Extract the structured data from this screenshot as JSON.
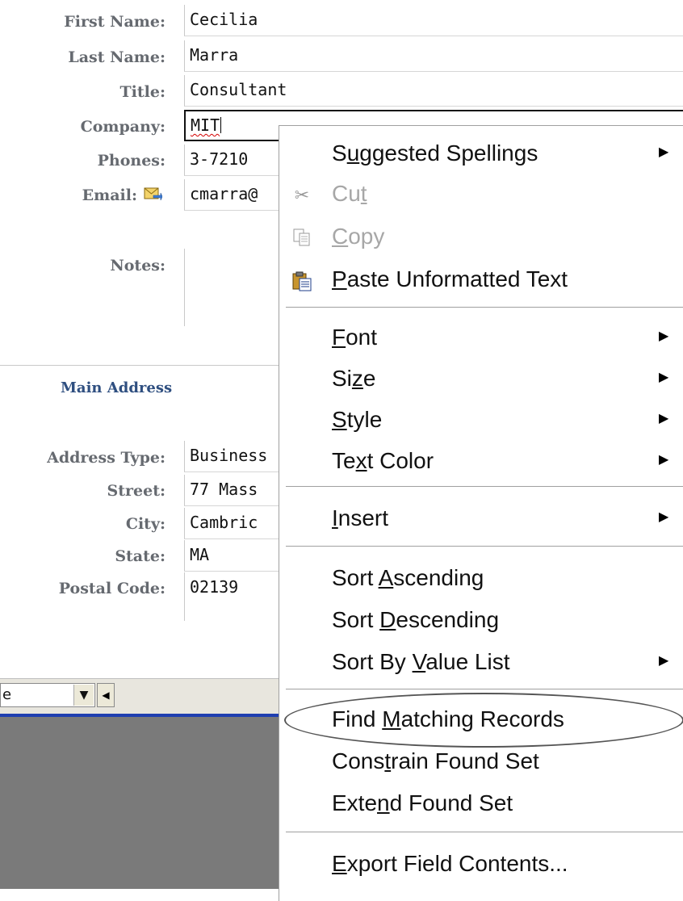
{
  "form": {
    "first_name": {
      "label": "First Name:",
      "value": "Cecilia"
    },
    "last_name": {
      "label": "Last Name:",
      "value": "Marra"
    },
    "title": {
      "label": "Title:",
      "value": "Consultant"
    },
    "company": {
      "label": "Company:",
      "value": "MIT"
    },
    "phones": {
      "label": "Phones:",
      "value": "3-7210"
    },
    "email": {
      "label": "Email:",
      "value": "cmarra@"
    },
    "notes": {
      "label": "Notes:",
      "value": ""
    }
  },
  "address": {
    "section_title": "Main Address",
    "type": {
      "label": "Address Type:",
      "value": "Business"
    },
    "street": {
      "label": "Street:",
      "value": "77 Mass"
    },
    "city": {
      "label": "City:",
      "value": "Cambric"
    },
    "state": {
      "label": "State:",
      "value": "MA"
    },
    "postal": {
      "label": "Postal Code:",
      "value": "02139"
    }
  },
  "statusbar": {
    "combo_value": "e"
  },
  "context_menu": {
    "items": [
      {
        "pre": "S",
        "key": "u",
        "post": "ggested Spellings",
        "submenu": true
      },
      {
        "pre": "Cu",
        "key": "t",
        "post": "",
        "disabled": true,
        "icon": "cut-icon"
      },
      {
        "pre": "",
        "key": "C",
        "post": "opy",
        "disabled": true,
        "icon": "copy-icon"
      },
      {
        "pre": "",
        "key": "P",
        "post": "aste Unformatted Text",
        "icon": "paste-icon"
      },
      {
        "pre": "",
        "key": "F",
        "post": "ont",
        "submenu": true
      },
      {
        "pre": "Si",
        "key": "z",
        "post": "e",
        "submenu": true
      },
      {
        "pre": "",
        "key": "S",
        "post": "tyle",
        "submenu": true
      },
      {
        "pre": "Te",
        "key": "x",
        "post": "t Color",
        "submenu": true
      },
      {
        "pre": "",
        "key": "I",
        "post": "nsert",
        "submenu": true
      },
      {
        "pre": "Sort ",
        "key": "A",
        "post": "scending"
      },
      {
        "pre": "Sort ",
        "key": "D",
        "post": "escending"
      },
      {
        "pre": "Sort By ",
        "key": "V",
        "post": "alue List",
        "submenu": true
      },
      {
        "pre": "Find ",
        "key": "M",
        "post": "atching Records"
      },
      {
        "pre": "Cons",
        "key": "t",
        "post": "rain Found Set"
      },
      {
        "pre": "Exte",
        "key": "n",
        "post": "d Found Set"
      },
      {
        "pre": "",
        "key": "E",
        "post": "xport Field Contents..."
      }
    ]
  }
}
